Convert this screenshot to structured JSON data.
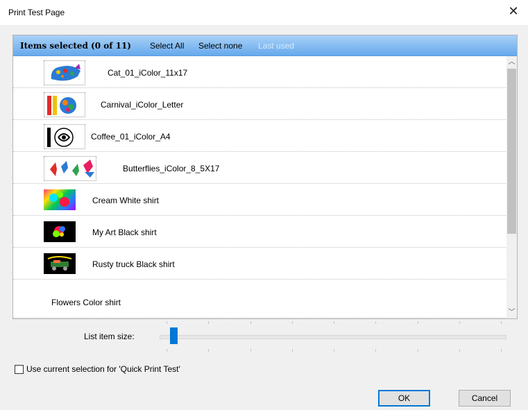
{
  "window": {
    "title": "Print Test Page",
    "close_glyph": "✕"
  },
  "header": {
    "count_label": "Items selected (0 of 11)",
    "select_all": "Select All",
    "select_none": "Select none",
    "last_used": "Last used"
  },
  "items": [
    {
      "label": "Cat_01_iColor_11x17",
      "thumb": "cat-thumbnail"
    },
    {
      "label": "Carnival_iColor_Letter",
      "thumb": "carnival-thumbnail"
    },
    {
      "label": "Coffee_01_iColor_A4",
      "thumb": "coffee-thumbnail"
    },
    {
      "label": "Butterflies_iColor_8_5X17",
      "thumb": "butterflies-thumbnail"
    },
    {
      "label": "Cream White shirt",
      "thumb": "cream-shirt-thumbnail"
    },
    {
      "label": "My Art Black shirt",
      "thumb": "art-black-thumbnail"
    },
    {
      "label": "Rusty truck Black shirt",
      "thumb": "truck-black-thumbnail"
    },
    {
      "label": "Flowers Color shirt",
      "thumb": ""
    }
  ],
  "slider": {
    "label": "List item size:",
    "value_fraction": 0.03
  },
  "quick_print": {
    "label": "Use current selection for 'Quick Print Test'",
    "checked": false
  },
  "buttons": {
    "ok": "OK",
    "cancel": "Cancel"
  },
  "colors": {
    "header_top": "#a9d1f7",
    "header_bottom": "#66a9ec",
    "accent": "#0078d7"
  }
}
